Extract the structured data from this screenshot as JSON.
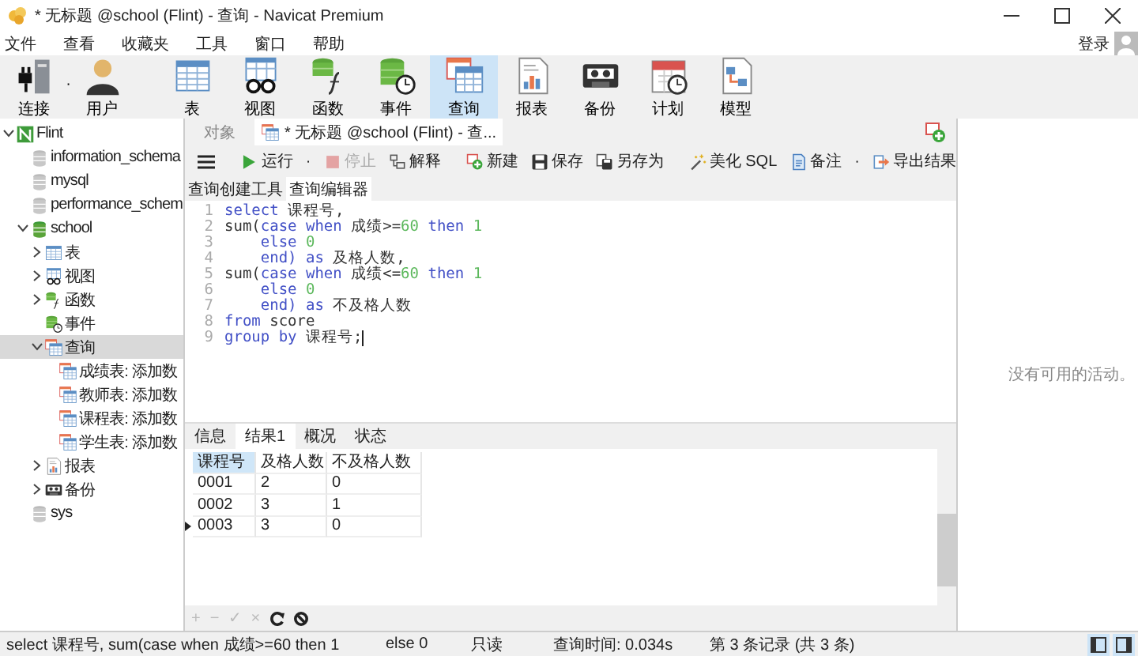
{
  "window": {
    "title": "* 无标题 @school (Flint) - 查询 - Navicat Premium"
  },
  "menu": [
    "文件",
    "查看",
    "收藏夹",
    "工具",
    "窗口",
    "帮助"
  ],
  "login": {
    "label": "登录"
  },
  "toolbar": [
    {
      "label": "连接",
      "kind": "connect",
      "selected": false,
      "dropdown": "·"
    },
    {
      "label": "用户",
      "kind": "user",
      "selected": false
    },
    {
      "label": "表",
      "kind": "table",
      "selected": false
    },
    {
      "label": "视图",
      "kind": "view",
      "selected": false
    },
    {
      "label": "函数",
      "kind": "func",
      "selected": false
    },
    {
      "label": "事件",
      "kind": "event",
      "selected": false
    },
    {
      "label": "查询",
      "kind": "query",
      "selected": true
    },
    {
      "label": "报表",
      "kind": "report",
      "selected": false
    },
    {
      "label": "备份",
      "kind": "backup",
      "selected": false
    },
    {
      "label": "计划",
      "kind": "schedule",
      "selected": false
    },
    {
      "label": "模型",
      "kind": "model",
      "selected": false
    }
  ],
  "sidebar": {
    "tree": [
      {
        "label": "Flint",
        "kind": "server",
        "expanded": true,
        "selected": false,
        "children": [
          {
            "label": "information_schema",
            "kind": "db",
            "selected": false
          },
          {
            "label": "mysql",
            "kind": "db",
            "selected": false
          },
          {
            "label": "performance_schem",
            "kind": "db",
            "selected": false
          },
          {
            "label": "school",
            "kind": "db-open",
            "expanded": true,
            "selected": false,
            "children": [
              {
                "label": "表",
                "kind": "table",
                "expanded": false,
                "selected": false
              },
              {
                "label": "视图",
                "kind": "view",
                "expanded": false,
                "selected": false
              },
              {
                "label": "函数",
                "kind": "func",
                "expanded": false,
                "selected": false
              },
              {
                "label": "事件",
                "kind": "event",
                "selected": false
              },
              {
                "label": "查询",
                "kind": "query",
                "expanded": true,
                "selected": true,
                "children": [
                  {
                    "label": "成绩表: 添加数",
                    "kind": "query",
                    "selected": false
                  },
                  {
                    "label": "教师表: 添加数",
                    "kind": "query",
                    "selected": false
                  },
                  {
                    "label": "课程表: 添加数",
                    "kind": "query",
                    "selected": false
                  },
                  {
                    "label": "学生表: 添加数",
                    "kind": "query",
                    "selected": false
                  }
                ]
              },
              {
                "label": "报表",
                "kind": "report",
                "expanded": false,
                "selected": false
              },
              {
                "label": "备份",
                "kind": "backup",
                "expanded": false,
                "selected": false
              }
            ]
          },
          {
            "label": "sys",
            "kind": "db",
            "selected": false
          }
        ]
      }
    ]
  },
  "doc_tabs": [
    {
      "label": "对象",
      "selected": false
    },
    {
      "label": "* 无标题 @school (Flint) - 查...",
      "selected": true
    }
  ],
  "editor_toolbar": [
    {
      "kind": "run",
      "label": "运行",
      "dropdown": "·",
      "disabled": false
    },
    {
      "kind": "stop",
      "label": "停止",
      "disabled": true
    },
    {
      "kind": "explain",
      "label": "解释",
      "disabled": false
    },
    {
      "kind": "new",
      "label": "新建",
      "disabled": false
    },
    {
      "kind": "save",
      "label": "保存",
      "disabled": false
    },
    {
      "kind": "saveas",
      "label": "另存为",
      "disabled": false
    },
    {
      "kind": "beautify",
      "label": "美化 SQL",
      "disabled": false
    },
    {
      "kind": "note",
      "label": "备注",
      "dropdown": "·",
      "disabled": false
    },
    {
      "kind": "export",
      "label": "导出结果",
      "disabled": false
    }
  ],
  "editor_tabs": [
    {
      "label": "查询创建工具",
      "selected": false
    },
    {
      "label": "查询编辑器",
      "selected": true
    }
  ],
  "editor": {
    "lines": [
      {
        "number": "1",
        "cursor": false,
        "tokens": [
          {
            "kind": "kw",
            "text": "select"
          },
          {
            "kind": "txt",
            "text": " 课程号,"
          }
        ]
      },
      {
        "number": "2",
        "cursor": false,
        "tokens": [
          {
            "kind": "txt",
            "text": "sum("
          },
          {
            "kind": "kw",
            "text": "case when"
          },
          {
            "kind": "txt",
            "text": " 成绩>="
          },
          {
            "kind": "num",
            "text": "60"
          },
          {
            "kind": "kw",
            "text": " then"
          },
          {
            "kind": "num",
            "text": " 1"
          }
        ]
      },
      {
        "number": "3",
        "cursor": false,
        "tokens": [
          {
            "kind": "kw",
            "text": "    else"
          },
          {
            "kind": "num",
            "text": " 0"
          }
        ]
      },
      {
        "number": "4",
        "cursor": false,
        "tokens": [
          {
            "kind": "kw",
            "text": "    end) as"
          },
          {
            "kind": "txt",
            "text": " 及格人数,"
          }
        ]
      },
      {
        "number": "5",
        "cursor": false,
        "tokens": [
          {
            "kind": "txt",
            "text": "sum("
          },
          {
            "kind": "kw",
            "text": "case when"
          },
          {
            "kind": "txt",
            "text": " 成绩<="
          },
          {
            "kind": "num",
            "text": "60"
          },
          {
            "kind": "kw",
            "text": " then"
          },
          {
            "kind": "num",
            "text": " 1"
          }
        ]
      },
      {
        "number": "6",
        "cursor": false,
        "tokens": [
          {
            "kind": "kw",
            "text": "    else"
          },
          {
            "kind": "num",
            "text": " 0"
          }
        ]
      },
      {
        "number": "7",
        "cursor": false,
        "tokens": [
          {
            "kind": "kw",
            "text": "    end) as"
          },
          {
            "kind": "txt",
            "text": " 不及格人数"
          }
        ]
      },
      {
        "number": "8",
        "cursor": false,
        "tokens": [
          {
            "kind": "kw",
            "text": "from"
          },
          {
            "kind": "txt",
            "text": " score"
          }
        ]
      },
      {
        "number": "9",
        "cursor": true,
        "tokens": [
          {
            "kind": "kw",
            "text": "group by"
          },
          {
            "kind": "txt",
            "text": " 课程号;"
          }
        ]
      }
    ]
  },
  "result_tabs": [
    {
      "label": "信息",
      "selected": false
    },
    {
      "label": "结果1",
      "selected": true
    },
    {
      "label": "概况",
      "selected": false
    },
    {
      "label": "状态",
      "selected": false
    }
  ],
  "grid": {
    "columns": [
      {
        "label": "课程号",
        "selected": true
      },
      {
        "label": "及格人数",
        "selected": false
      },
      {
        "label": "不及格人数",
        "selected": false
      }
    ],
    "rows": [
      {
        "cells": [
          "0001",
          "2",
          "0"
        ],
        "selected": false
      },
      {
        "cells": [
          "0002",
          "3",
          "1"
        ],
        "selected": false
      },
      {
        "cells": [
          "0003",
          "3",
          "0"
        ],
        "selected": true
      }
    ]
  },
  "grid_toolbar": [
    {
      "kind": "text",
      "label": "+",
      "disabled": true
    },
    {
      "kind": "text",
      "label": "−",
      "disabled": true
    },
    {
      "kind": "text",
      "label": "✓",
      "disabled": true
    },
    {
      "kind": "text",
      "label": "×",
      "disabled": true
    },
    {
      "kind": "refresh",
      "disabled": false
    },
    {
      "kind": "cancel",
      "disabled": false
    }
  ],
  "activity": {
    "message": "没有可用的活动。"
  },
  "status_bar": [
    {
      "kind": "sql",
      "text": "select 课程号, sum(case when 成绩>=60 then 1"
    },
    {
      "kind": "sql2",
      "text": "else 0"
    },
    {
      "kind": "mode",
      "text": "只读"
    },
    {
      "kind": "time",
      "text": "查询时间: 0.034s"
    },
    {
      "kind": "record",
      "text": "第 3 条记录 (共 3 条)"
    }
  ]
}
